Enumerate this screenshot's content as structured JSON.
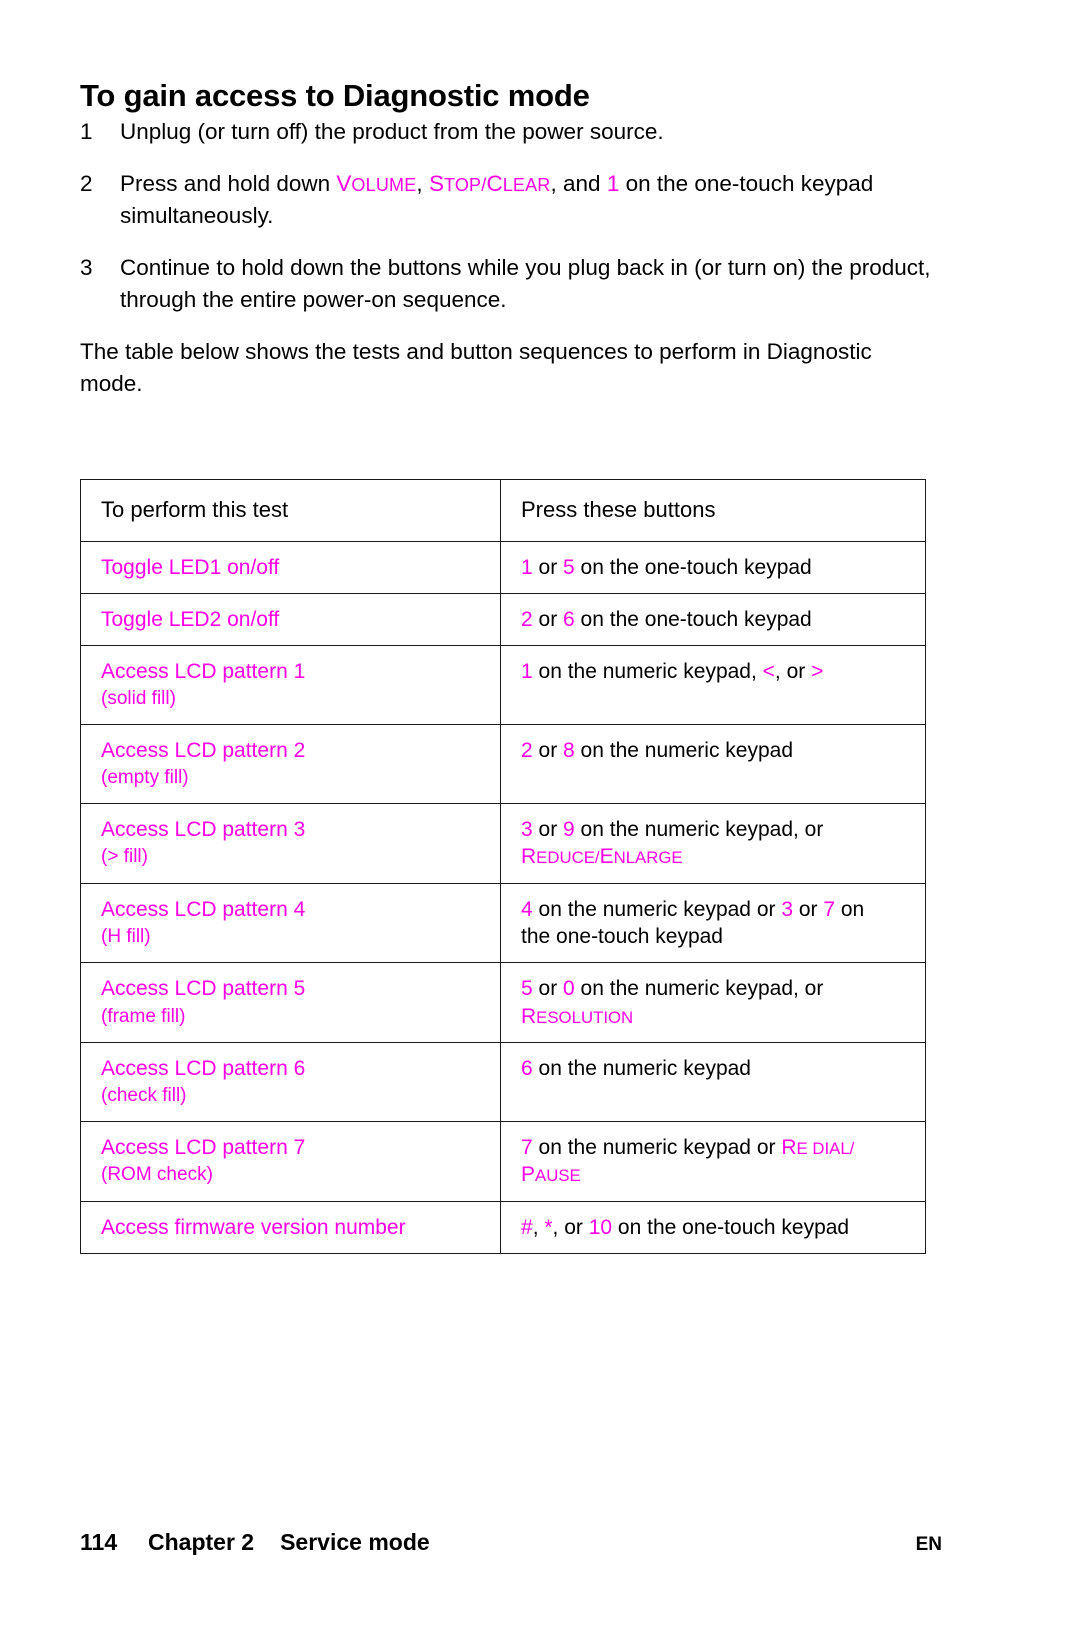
{
  "page": {
    "heading": "To gain access to Diagnostic mode",
    "accent_color": "#ff00e6",
    "text_color": "#000000",
    "background_color": "#ffffff"
  },
  "steps": [
    {
      "number": "1",
      "text": "Unplug (or turn off) the product from the power source."
    },
    {
      "number": "2",
      "prefix": "Press and hold down ",
      "key1_cap": "V",
      "key1_rest": "OLUME",
      "sep1": ", ",
      "key2_cap": "S",
      "key2_rest": "TOP/",
      "key3_cap": "C",
      "key3_rest": "LEAR",
      "sep2": ", and ",
      "key4": "1",
      "suffix": " on the one-touch keypad simultaneously."
    },
    {
      "number": "3",
      "text": "Continue to hold down the buttons while you plug back in (or turn on) the product, through the entire power-on sequence."
    }
  ],
  "intro_paragraph": "The table below shows the tests and button sequences to perform in Diagnostic mode.",
  "table": {
    "headers": [
      "To perform this test",
      "Press these buttons"
    ],
    "rows": [
      {
        "test": "Toggle LED1 on/off",
        "test_sub": "",
        "press_line1_parts": [
          {
            "t": "1",
            "k": true
          },
          {
            "t": " or ",
            "k": false
          },
          {
            "t": "5",
            "k": true
          },
          {
            "t": " on the one-touch keypad",
            "k": false
          }
        ],
        "press_line2_parts": []
      },
      {
        "test": "Toggle LED2 on/off",
        "test_sub": "",
        "press_line1_parts": [
          {
            "t": "2",
            "k": true
          },
          {
            "t": " or ",
            "k": false
          },
          {
            "t": "6",
            "k": true
          },
          {
            "t": " on the one-touch keypad",
            "k": false
          }
        ],
        "press_line2_parts": []
      },
      {
        "test": "Access LCD pattern 1",
        "test_sub": "(solid fill)",
        "press_line1_parts": [
          {
            "t": "1",
            "k": true
          },
          {
            "t": " on the numeric keypad, ",
            "k": false
          },
          {
            "t": "<",
            "k": true
          },
          {
            "t": ", or ",
            "k": false
          },
          {
            "t": ">",
            "k": true
          }
        ],
        "press_line2_parts": []
      },
      {
        "test": "Access LCD pattern 2",
        "test_sub": "(empty fill)",
        "press_line1_parts": [
          {
            "t": "2",
            "k": true
          },
          {
            "t": " or ",
            "k": false
          },
          {
            "t": "8",
            "k": true
          },
          {
            "t": " on the numeric keypad",
            "k": false
          }
        ],
        "press_line2_parts": []
      },
      {
        "test": "Access LCD pattern 3",
        "test_sub": "(> fill)",
        "press_line1_parts": [
          {
            "t": "3",
            "k": true
          },
          {
            "t": " or ",
            "k": false
          },
          {
            "t": "9",
            "k": true
          },
          {
            "t": " on the numeric keypad, or",
            "k": false
          }
        ],
        "press_line2_parts": [
          {
            "t": "R",
            "k": true,
            "cap": true
          },
          {
            "t": "EDUCE/",
            "k": true,
            "sc": true
          },
          {
            "t": "E",
            "k": true,
            "cap": true
          },
          {
            "t": "NLARGE",
            "k": true,
            "sc": true
          }
        ]
      },
      {
        "test": "Access LCD pattern 4",
        "test_sub": "(H fill)",
        "press_line1_parts": [
          {
            "t": "4",
            "k": true
          },
          {
            "t": " on the numeric keypad or ",
            "k": false
          },
          {
            "t": "3",
            "k": true
          },
          {
            "t": " or ",
            "k": false
          },
          {
            "t": "7",
            "k": true
          },
          {
            "t": " on",
            "k": false
          }
        ],
        "press_line2_parts": [
          {
            "t": "the one-touch keypad",
            "k": false
          }
        ]
      },
      {
        "test": "Access LCD pattern 5",
        "test_sub": "(frame fill)",
        "press_line1_parts": [
          {
            "t": "5",
            "k": true
          },
          {
            "t": " or ",
            "k": false
          },
          {
            "t": "0",
            "k": true
          },
          {
            "t": " on the numeric keypad, or",
            "k": false
          }
        ],
        "press_line2_parts": [
          {
            "t": "R",
            "k": true,
            "cap": true
          },
          {
            "t": "ESOLUTION",
            "k": true,
            "sc": true
          }
        ]
      },
      {
        "test": "Access LCD pattern 6",
        "test_sub": "(check fill)",
        "press_line1_parts": [
          {
            "t": "6",
            "k": true
          },
          {
            "t": " on the numeric keypad",
            "k": false
          }
        ],
        "press_line2_parts": []
      },
      {
        "test": "Access LCD pattern 7",
        "test_sub": "(ROM check)",
        "press_line1_parts": [
          {
            "t": "7",
            "k": true
          },
          {
            "t": " on the numeric keypad or ",
            "k": false
          },
          {
            "t": "R",
            "k": true,
            "cap": true
          },
          {
            "t": "E ",
            "k": true,
            "sc": true
          },
          {
            "t": "DIAL/",
            "k": true,
            "sc": true
          }
        ],
        "press_line2_parts": [
          {
            "t": "P",
            "k": true,
            "cap": true
          },
          {
            "t": "AUSE",
            "k": true,
            "sc": true
          }
        ]
      },
      {
        "test": "Access firmware version number",
        "test_sub": "",
        "press_line1_parts": [
          {
            "t": "#",
            "k": true
          },
          {
            "t": ", ",
            "k": false
          },
          {
            "t": "*",
            "k": true
          },
          {
            "t": ", or ",
            "k": false
          },
          {
            "t": "10",
            "k": true
          },
          {
            "t": " on the one-touch keypad",
            "k": false
          }
        ],
        "press_line2_parts": []
      }
    ]
  },
  "footer": {
    "page_number": "114",
    "chapter": "Chapter 2",
    "section": "Service mode",
    "language": "EN"
  }
}
